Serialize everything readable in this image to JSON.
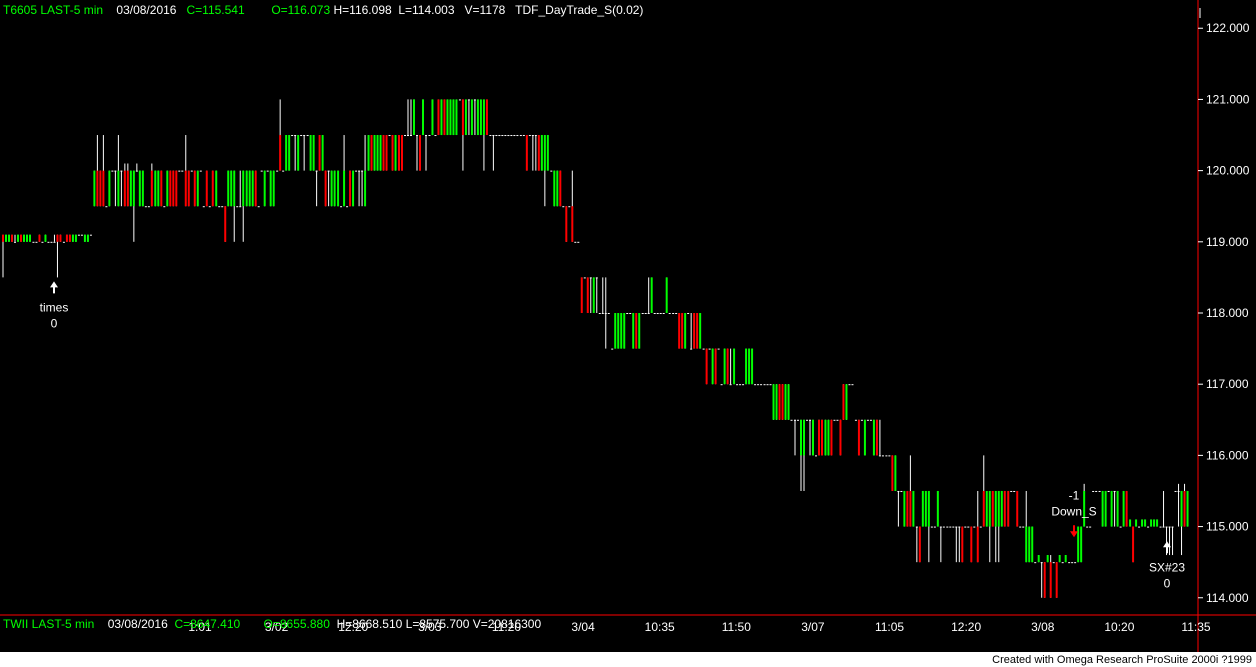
{
  "header": {
    "symbol": "T6605 LAST-5 min",
    "date": "03/08/2016",
    "close": "C=115.541",
    "open": "O=116.073",
    "high": "H=116.098",
    "low": "L=114.003",
    "volume": "V=1178",
    "study": "TDF_DayTrade_S(0.02)"
  },
  "subchart": {
    "symbol": "TWII LAST-5 min",
    "date": "03/08/2016",
    "close": "C=8647.410",
    "open": "O=8655.880",
    "high": "H=8668.510",
    "low": "L=8575.700",
    "volume": "V=20816300"
  },
  "footer": "Created with Omega Research ProSuite 2000i ?1999",
  "colors": {
    "background": "#000000",
    "up": "#00ff00",
    "down": "#ff0000",
    "neutral": "#ffffff",
    "divider": "#ff0000"
  },
  "chart_data": {
    "type": "bar",
    "subtype": "ohlc-candles",
    "ylim": [
      113.8,
      122.2
    ],
    "yticks": [
      "122.000",
      "121.000",
      "120.000",
      "119.000",
      "118.000",
      "117.000",
      "116.000",
      "115.000",
      "114.000"
    ],
    "xticks": [
      "1:01",
      "3/02",
      "12:20",
      "3/03",
      "11:20",
      "3/04",
      "10:35",
      "11:50",
      "3/07",
      "11:05",
      "12:20",
      "3/08",
      "10:20",
      "11:35"
    ],
    "grid": false,
    "annotations": [
      {
        "label": "times",
        "value": "0",
        "y": 118.5
      },
      {
        "label": "Down_S",
        "value": "-1",
        "y": 114.85
      },
      {
        "label": "SX#23",
        "value": "0",
        "y": 114.85
      }
    ],
    "segments": [
      {
        "o": 119.05,
        "h": 119.1,
        "l": 118.5,
        "c": 119.05
      },
      {
        "o": 119.05,
        "h": 119.1,
        "l": 118.5,
        "c": 119.0
      },
      {
        "o": 119.0,
        "h": 119.1,
        "l": 119.0,
        "c": 119.5
      },
      {
        "o": 119.5,
        "h": 120.5,
        "l": 119.5,
        "c": 120.0
      },
      {
        "o": 120.0,
        "h": 120.1,
        "l": 119.0,
        "c": 119.5
      },
      {
        "o": 119.5,
        "h": 120.0,
        "l": 119.0,
        "c": 120.0
      },
      {
        "o": 120.0,
        "h": 120.5,
        "l": 119.5,
        "c": 119.5
      },
      {
        "o": 119.5,
        "h": 120.0,
        "l": 119.0,
        "c": 119.5
      },
      {
        "o": 119.5,
        "h": 120.5,
        "l": 119.5,
        "c": 120.0
      },
      {
        "o": 120.0,
        "h": 121.0,
        "l": 119.5,
        "c": 120.5
      },
      {
        "o": 120.5,
        "h": 120.5,
        "l": 119.5,
        "c": 119.5
      },
      {
        "o": 119.5,
        "h": 120.5,
        "l": 119.5,
        "c": 120.0
      },
      {
        "o": 120.0,
        "h": 120.5,
        "l": 120.0,
        "c": 120.5
      },
      {
        "o": 120.5,
        "h": 121.0,
        "l": 120.0,
        "c": 120.5
      },
      {
        "o": 120.5,
        "h": 122.0,
        "l": 120.5,
        "c": 121.0
      },
      {
        "o": 121.0,
        "h": 121.0,
        "l": 120.0,
        "c": 120.5
      },
      {
        "o": 120.5,
        "h": 120.5,
        "l": 120.0,
        "c": 120.5
      },
      {
        "o": 120.5,
        "h": 120.5,
        "l": 119.5,
        "c": 120.0
      },
      {
        "o": 120.0,
        "h": 120.0,
        "l": 119.0,
        "c": 119.0
      },
      {
        "o": 118.5,
        "h": 118.5,
        "l": 117.5,
        "c": 118.0
      },
      {
        "o": 117.5,
        "h": 118.0,
        "l": 117.5,
        "c": 118.0
      },
      {
        "o": 118.0,
        "h": 118.5,
        "l": 118.0,
        "c": 118.0
      },
      {
        "o": 118.0,
        "h": 118.0,
        "l": 117.0,
        "c": 117.5
      },
      {
        "o": 117.5,
        "h": 117.5,
        "l": 117.0,
        "c": 117.0
      },
      {
        "o": 117.0,
        "h": 117.5,
        "l": 117.0,
        "c": 117.0
      },
      {
        "o": 117.0,
        "h": 117.0,
        "l": 116.5,
        "c": 116.5
      },
      {
        "o": 116.5,
        "h": 117.0,
        "l": 115.5,
        "c": 116.0
      },
      {
        "o": 116.0,
        "h": 117.0,
        "l": 116.0,
        "c": 117.0
      },
      {
        "o": 116.5,
        "h": 116.5,
        "l": 116.0,
        "c": 116.0
      },
      {
        "o": 116.0,
        "h": 116.0,
        "l": 115.0,
        "c": 115.0
      },
      {
        "o": 115.0,
        "h": 115.5,
        "l": 114.5,
        "c": 115.0
      },
      {
        "o": 115.0,
        "h": 115.0,
        "l": 114.5,
        "c": 115.0
      },
      {
        "o": 115.0,
        "h": 116.1,
        "l": 114.5,
        "c": 115.5
      },
      {
        "o": 115.5,
        "h": 115.5,
        "l": 114.5,
        "c": 114.5
      },
      {
        "o": 114.5,
        "h": 114.6,
        "l": 114.0,
        "c": 114.5
      },
      {
        "o": 114.5,
        "h": 115.6,
        "l": 114.5,
        "c": 115.5
      },
      {
        "o": 115.5,
        "h": 115.5,
        "l": 115.0,
        "c": 115.0
      },
      {
        "o": 115.0,
        "h": 115.1,
        "l": 114.5,
        "c": 115.0
      },
      {
        "o": 115.0,
        "h": 115.6,
        "l": 114.6,
        "c": 115.54
      }
    ]
  }
}
